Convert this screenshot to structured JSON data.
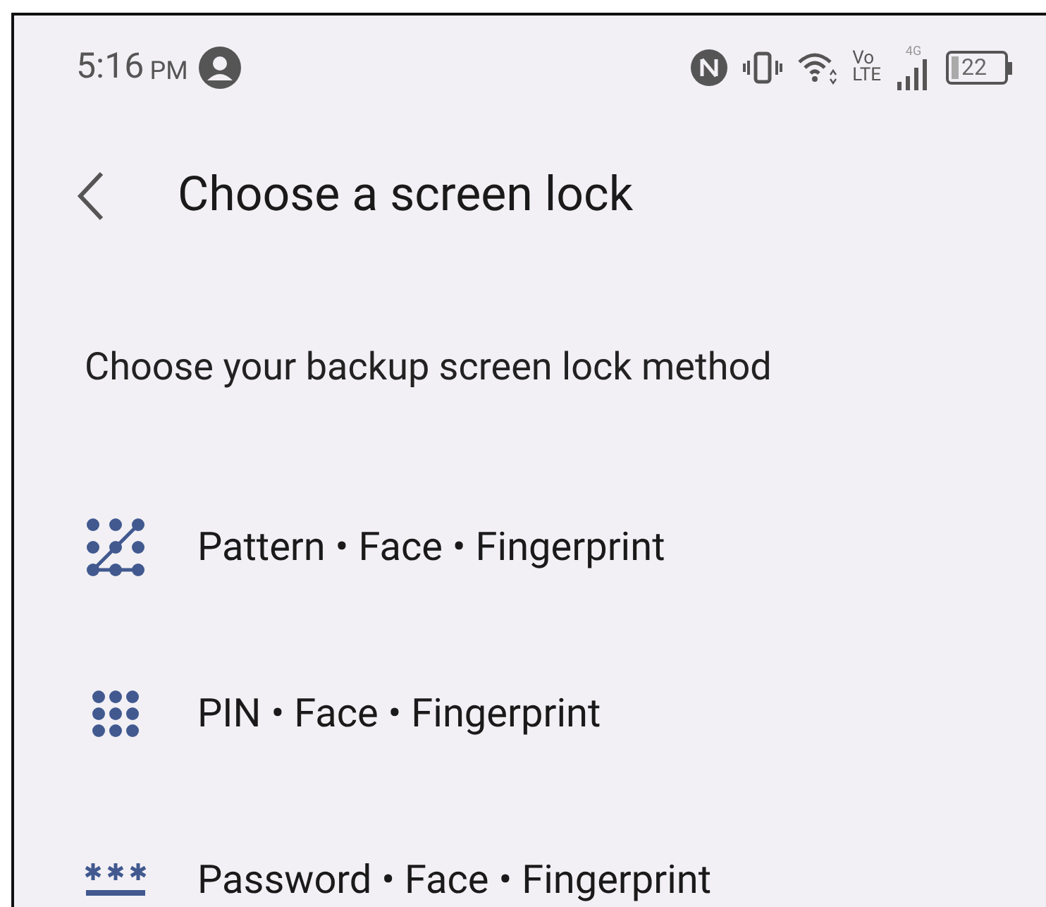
{
  "status_bar": {
    "time": "5:16",
    "ampm": "PM",
    "volte_top": "Vo",
    "volte_bottom": "LTE",
    "network": "4G",
    "battery": "22"
  },
  "header": {
    "title": "Choose a screen lock"
  },
  "subtitle": "Choose your backup screen lock method",
  "options": [
    {
      "kind": "pattern",
      "label": "Pattern • Face • Fingerprint"
    },
    {
      "kind": "pin",
      "label": "PIN • Face • Fingerprint"
    },
    {
      "kind": "password",
      "label": "Password • Face • Fingerprint"
    }
  ]
}
